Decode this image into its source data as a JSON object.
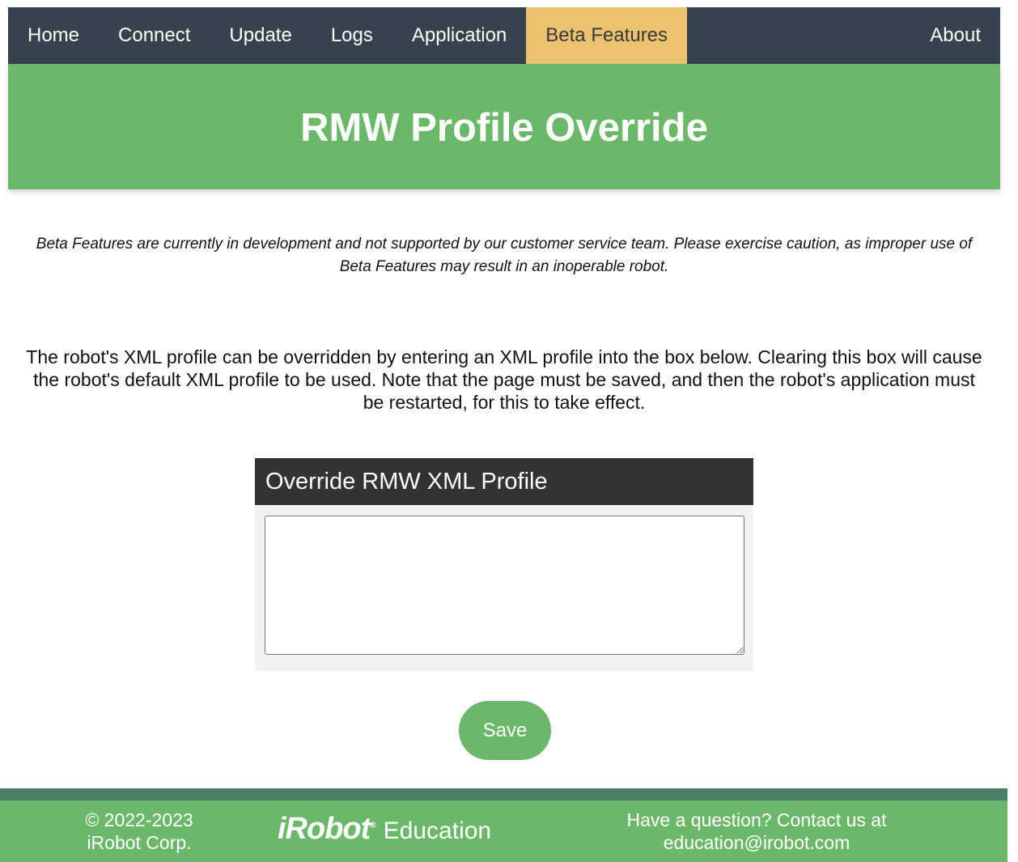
{
  "nav": {
    "items": [
      {
        "label": "Home"
      },
      {
        "label": "Connect"
      },
      {
        "label": "Update"
      },
      {
        "label": "Logs"
      },
      {
        "label": "Application"
      },
      {
        "label": "Beta Features"
      }
    ],
    "active": "Beta Features",
    "about": "About"
  },
  "banner": {
    "title": "RMW Profile Override"
  },
  "warning": "Beta Features are currently in development and not supported by our customer service team. Please exercise caution, as improper use of Beta Features may result in an inoperable robot.",
  "description": "The robot's XML profile can be overridden by entering an XML profile into the box below. Clearing this box will cause the robot's default XML profile to be used. Note that the page must be saved, and then the robot's application must be restarted, for this to take effect.",
  "card": {
    "title": "Override RMW XML Profile",
    "value": ""
  },
  "save_label": "Save",
  "footer": {
    "copyright_line1": "© 2022-2023",
    "copyright_line2": "iRobot Corp.",
    "logo_brand": "iRobot",
    "logo_suffix": "Education",
    "contact_line1": "Have a question? Contact us at",
    "contact_line2": "education@irobot.com"
  },
  "colors": {
    "nav_bg": "#36434e",
    "active_tab": "#ebc26f",
    "brand_green": "#6cb86a",
    "footer_strip": "#4a7f6a",
    "card_header": "#333333"
  }
}
